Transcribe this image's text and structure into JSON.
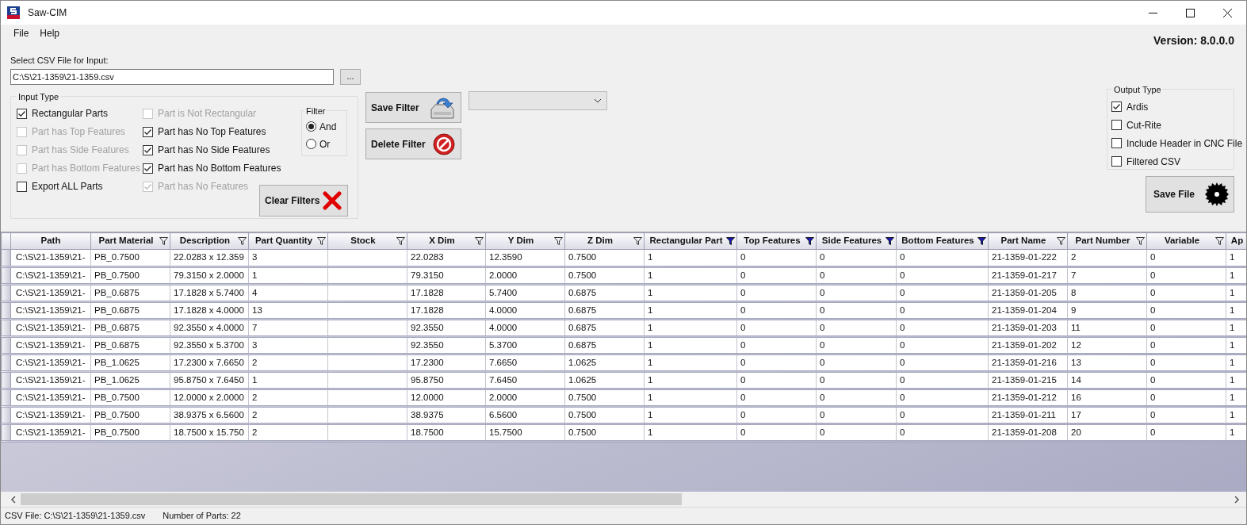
{
  "window": {
    "title": "Saw-CIM"
  },
  "menu": [
    "File",
    "Help"
  ],
  "version": "Version: 8.0.0.0",
  "csv_input": {
    "label": "Select CSV File for Input:",
    "value": "C:\\S\\21-1359\\21-1359.csv",
    "browse_button": "..."
  },
  "input_type": {
    "title": "Input Type",
    "columns": [
      [
        {
          "label": "Rectangular Parts",
          "checked": true,
          "disabled": false
        },
        {
          "label": "Part has Top Features",
          "checked": false,
          "disabled": true
        },
        {
          "label": "Part has Side Features",
          "checked": false,
          "disabled": true
        },
        {
          "label": "Part has Bottom Features",
          "checked": false,
          "disabled": true
        },
        {
          "label": "Export ALL Parts",
          "checked": false,
          "disabled": false
        }
      ],
      [
        {
          "label": "Part is Not Rectangular",
          "checked": false,
          "disabled": true
        },
        {
          "label": "Part has No Top Features",
          "checked": true,
          "disabled": false
        },
        {
          "label": "Part has No Side Features",
          "checked": true,
          "disabled": false
        },
        {
          "label": "Part has No Bottom Features",
          "checked": true,
          "disabled": false
        },
        {
          "label": "Part has No Features",
          "checked": true,
          "disabled": true
        }
      ]
    ]
  },
  "filter": {
    "title": "Filter",
    "options": [
      {
        "label": "And",
        "selected": true
      },
      {
        "label": "Or",
        "selected": false
      }
    ]
  },
  "save_filter_button": "Save Filter",
  "delete_filter_button": "Delete Filter",
  "clear_filters_button": "Clear Filters",
  "output_type": {
    "title": "Output Type",
    "options": [
      {
        "label": "Ardis",
        "checked": true
      },
      {
        "label": "Cut-Rite",
        "checked": false
      },
      {
        "label": "Include Header in CNC File",
        "checked": false
      },
      {
        "label": "Filtered CSV",
        "checked": false
      }
    ]
  },
  "save_file_button": "Save File",
  "table": {
    "columns": [
      {
        "label": "Path",
        "filterable": false
      },
      {
        "label": "Part Material",
        "filterable": true,
        "filtered": false
      },
      {
        "label": "Description",
        "filterable": true,
        "filtered": false
      },
      {
        "label": "Part Quantity",
        "filterable": true,
        "filtered": false
      },
      {
        "label": "Stock",
        "filterable": true,
        "filtered": false
      },
      {
        "label": "X Dim",
        "filterable": true,
        "filtered": false
      },
      {
        "label": "Y Dim",
        "filterable": true,
        "filtered": false
      },
      {
        "label": "Z Dim",
        "filterable": true,
        "filtered": false
      },
      {
        "label": "Rectangular Part",
        "filterable": true,
        "filtered": true
      },
      {
        "label": "Top Features",
        "filterable": true,
        "filtered": true
      },
      {
        "label": "Side Features",
        "filterable": true,
        "filtered": true
      },
      {
        "label": "Bottom Features",
        "filterable": true,
        "filtered": true
      },
      {
        "label": "Part Name",
        "filterable": true,
        "filtered": false
      },
      {
        "label": "Part Number",
        "filterable": true,
        "filtered": false
      },
      {
        "label": "Variable",
        "filterable": true,
        "filtered": false
      },
      {
        "label": "Ap",
        "filterable": false
      }
    ],
    "rows": [
      [
        "C:\\S\\21-1359\\21-",
        "PB_0.7500",
        "22.0283 x 12.359",
        "3",
        null,
        "22.0283",
        "12.3590",
        "0.7500",
        "1",
        "0",
        "0",
        "0",
        "21-1359-01-222",
        "2",
        "0",
        "1"
      ],
      [
        "C:\\S\\21-1359\\21-",
        "PB_0.7500",
        "79.3150 x 2.0000",
        "1",
        null,
        "79.3150",
        "2.0000",
        "0.7500",
        "1",
        "0",
        "0",
        "0",
        "21-1359-01-217",
        "7",
        "0",
        "1"
      ],
      [
        "C:\\S\\21-1359\\21-",
        "PB_0.6875",
        "17.1828 x 5.7400",
        "4",
        null,
        "17.1828",
        "5.7400",
        "0.6875",
        "1",
        "0",
        "0",
        "0",
        "21-1359-01-205",
        "8",
        "0",
        "1"
      ],
      [
        "C:\\S\\21-1359\\21-",
        "PB_0.6875",
        "17.1828 x 4.0000",
        "13",
        null,
        "17.1828",
        "4.0000",
        "0.6875",
        "1",
        "0",
        "0",
        "0",
        "21-1359-01-204",
        "9",
        "0",
        "1"
      ],
      [
        "C:\\S\\21-1359\\21-",
        "PB_0.6875",
        "92.3550 x 4.0000",
        "7",
        null,
        "92.3550",
        "4.0000",
        "0.6875",
        "1",
        "0",
        "0",
        "0",
        "21-1359-01-203",
        "11",
        "0",
        "1"
      ],
      [
        "C:\\S\\21-1359\\21-",
        "PB_0.6875",
        "92.3550 x 5.3700",
        "3",
        null,
        "92.3550",
        "5.3700",
        "0.6875",
        "1",
        "0",
        "0",
        "0",
        "21-1359-01-202",
        "12",
        "0",
        "1"
      ],
      [
        "C:\\S\\21-1359\\21-",
        "PB_1.0625",
        "17.2300 x 7.6650",
        "2",
        null,
        "17.2300",
        "7.6650",
        "1.0625",
        "1",
        "0",
        "0",
        "0",
        "21-1359-01-216",
        "13",
        "0",
        "1"
      ],
      [
        "C:\\S\\21-1359\\21-",
        "PB_1.0625",
        "95.8750 x 7.6450",
        "1",
        null,
        "95.8750",
        "7.6450",
        "1.0625",
        "1",
        "0",
        "0",
        "0",
        "21-1359-01-215",
        "14",
        "0",
        "1"
      ],
      [
        "C:\\S\\21-1359\\21-",
        "PB_0.7500",
        "12.0000 x 2.0000",
        "2",
        null,
        "12.0000",
        "2.0000",
        "0.7500",
        "1",
        "0",
        "0",
        "0",
        "21-1359-01-212",
        "16",
        "0",
        "1"
      ],
      [
        "C:\\S\\21-1359\\21-",
        "PB_0.7500",
        "38.9375 x 6.5600",
        "2",
        null,
        "38.9375",
        "6.5600",
        "0.7500",
        "1",
        "0",
        "0",
        "0",
        "21-1359-01-211",
        "17",
        "0",
        "1"
      ],
      [
        "C:\\S\\21-1359\\21-",
        "PB_0.7500",
        "18.7500 x 15.750",
        "2",
        null,
        "18.7500",
        "15.7500",
        "0.7500",
        "1",
        "0",
        "0",
        "0",
        "21-1359-01-208",
        "20",
        "0",
        "1"
      ]
    ]
  },
  "status_bar": [
    "CSV File: C:\\S\\21-1359\\21-1359.csv",
    "Number of Parts: 22"
  ]
}
